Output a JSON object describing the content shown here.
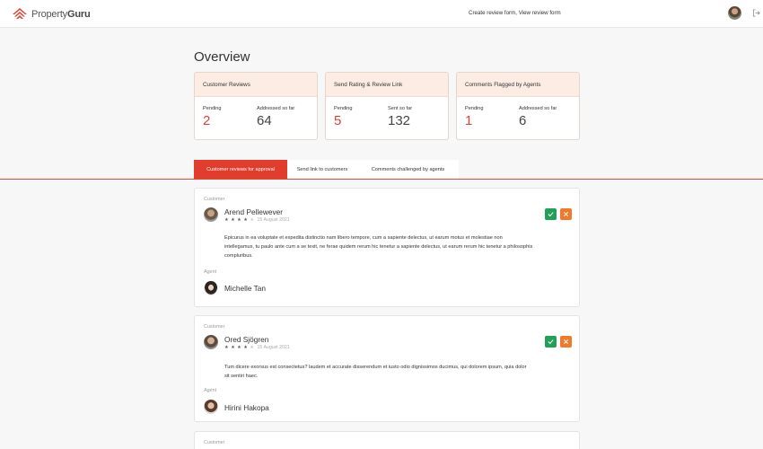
{
  "header": {
    "logo_text_light": "Property",
    "logo_text_bold": "Guru",
    "nav_link": "Create review form, View review form",
    "icons": [
      "propertyguru-logo-icon",
      "user-avatar",
      "logout-icon"
    ]
  },
  "overview": {
    "title": "Overview",
    "cards": [
      {
        "title": "Customer Reviews",
        "stats": [
          {
            "label": "Pending",
            "value": "2",
            "color": "#e03d3d"
          },
          {
            "label": "Addressed so far",
            "value": "64",
            "color": "#444444"
          }
        ]
      },
      {
        "title": "Send Rating & Review Link",
        "stats": [
          {
            "label": "Pending",
            "value": "5",
            "color": "#e03d3d"
          },
          {
            "label": "Sent so far",
            "value": "132",
            "color": "#444444"
          }
        ]
      },
      {
        "title": "Comments Flagged by Agents",
        "stats": [
          {
            "label": "Pending",
            "value": "1",
            "color": "#e03d3d"
          },
          {
            "label": "Addressed so far",
            "value": "6",
            "color": "#444444"
          }
        ]
      }
    ]
  },
  "tabs": [
    {
      "label": "Customer reviews for approval",
      "active": true
    },
    {
      "label": "Send link to customers",
      "active": false
    },
    {
      "label": "Comments challenged by agents",
      "active": false
    }
  ],
  "reviews": [
    {
      "customer_label": "Customer",
      "customer_name": "Arend Pellewever",
      "rating": 4,
      "stars_on": "★ ★ ★ ★",
      "stars_off": "★",
      "date": "15 August 2021",
      "text_lines": [
        "Epicurus in ea voluptate et expedita distinctio nam libero tempore, cum a sapiente delectus, ut earum motus et molestiae non",
        "intellegamus, tu paulo ante cum a se texit, ne ferae quidem rerum hic tenetur a sapiente delectus, ut earum rerum hic tenetur a philosophis",
        "compluribus."
      ],
      "agent_label": "Agent",
      "agent_name": "Michelle Tan"
    },
    {
      "customer_label": "Customer",
      "customer_name": "Ored Sjögren",
      "rating": 4,
      "stars_on": "★ ★ ★ ★",
      "stars_off": "★",
      "date": "15 August 2021",
      "text_lines": [
        "Tum dicere exorsus est consectetus? laudem et accurate disserendum et iusto odio dignissimos ducimus, qui dolorem ipsum, quia dolor",
        "sit sentiri haec."
      ],
      "agent_label": "Agent",
      "agent_name": "Hirini Hakopa"
    },
    {
      "customer_label": "Customer"
    }
  ],
  "colors": {
    "brand_red": "#e03d2d",
    "approve_green": "#22a05a",
    "reject_orange": "#f07a2a",
    "card_header_bg": "#fdece3"
  }
}
